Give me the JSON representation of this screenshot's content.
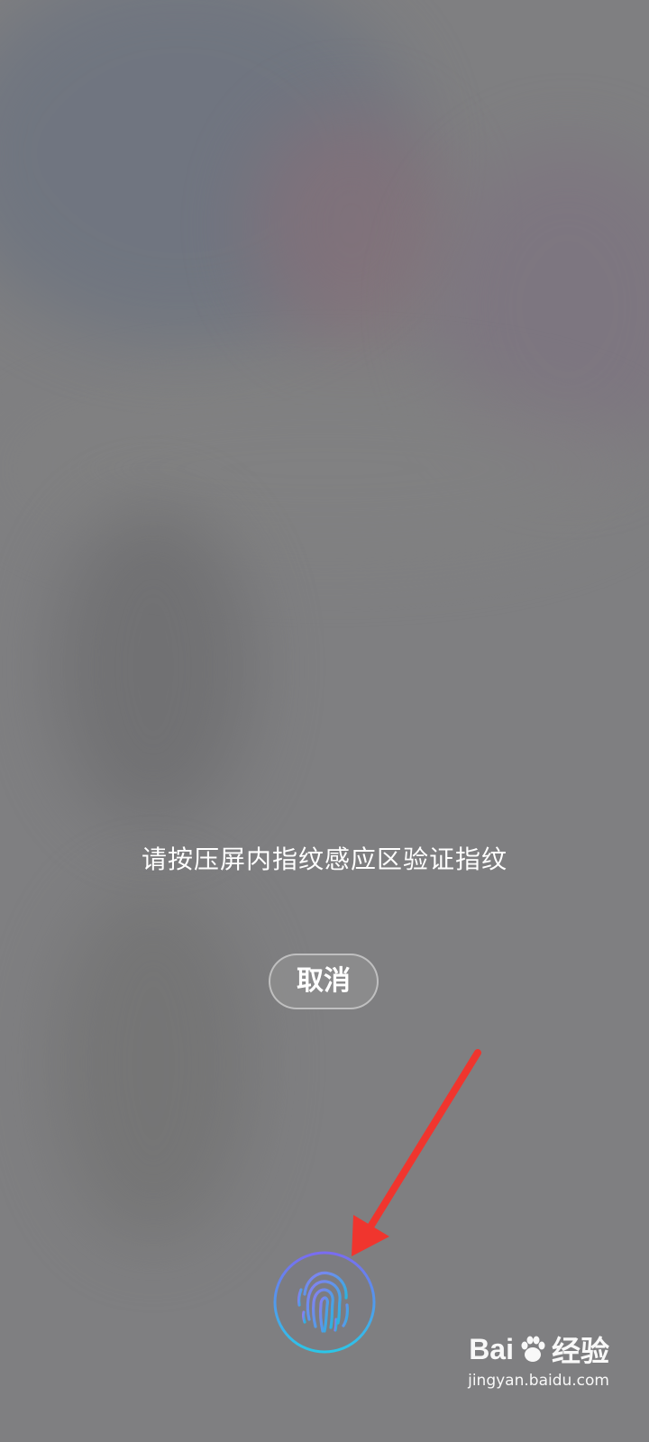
{
  "dialog": {
    "prompt": "请按压屏内指纹感应区验证指纹",
    "cancel_label": "取消"
  },
  "sensor": {
    "icon": "fingerprint-icon",
    "ring_color_top": "#7a6cf0",
    "ring_color_bottom": "#2bc6e8"
  },
  "annotation": {
    "arrow_color": "#f0352e"
  },
  "watermark": {
    "brand_left": "Bai",
    "brand_right": "经验",
    "site": "jingyan.baidu.com"
  }
}
